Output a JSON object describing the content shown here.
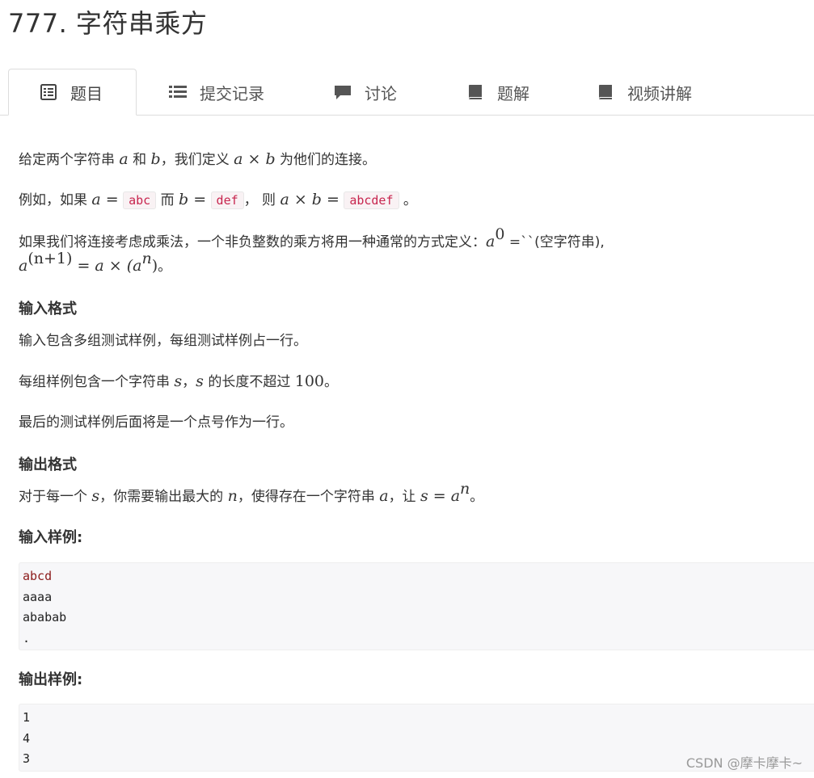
{
  "problem": {
    "title": "777. 字符串乘方"
  },
  "tabs": [
    {
      "label": "题目",
      "icon": "list-alt-icon"
    },
    {
      "label": "提交记录",
      "icon": "list-icon"
    },
    {
      "label": "讨论",
      "icon": "comment-icon"
    },
    {
      "label": "题解",
      "icon": "book-icon"
    },
    {
      "label": "视频讲解",
      "icon": "book-icon"
    }
  ],
  "desc": {
    "p1": {
      "a": "给定两个字符串 ",
      "b": " 和 ",
      "c": "，我们定义 ",
      "d": " 为他们的连接。",
      "var_a": "a",
      "var_b": "b",
      "expr": "a × b"
    },
    "p2": {
      "a": "例如，如果 ",
      "eq_a": "a =",
      "code1": "abc",
      "b": " 而 ",
      "eq_b": "b =",
      "code2": "def",
      "c": "， 则 ",
      "eq_ab": "a × b =",
      "code3": "abcdef",
      "d": " 。"
    },
    "p3": {
      "a": "如果我们将连接考虑成乘法，一个非负整数的乘方将用一种通常的方式定义：",
      "base": "a",
      "sup0": "0",
      "eq": " =``(空字符串),",
      "l2_base": "a",
      "l2_sup": "(n+1)",
      "l2_eq": " = a × (a",
      "l2_sup2": "n",
      "l2_end": ")",
      "l2_period": "。"
    }
  },
  "input_format": {
    "heading": "输入格式",
    "p1": "输入包含多组测试样例，每组测试样例占一行。",
    "p2": {
      "a": "每组样例包含一个字符串 ",
      "s1": "s",
      "b": "，",
      "s2": "s",
      "c": " 的长度不超过 ",
      "n": "100",
      "d": "。"
    },
    "p3": "最后的测试样例后面将是一个点号作为一行。"
  },
  "output_format": {
    "heading": "输出格式",
    "p1": {
      "a": "对于每一个 ",
      "s": "s",
      "b": "，你需要输出最大的 ",
      "n": "n",
      "c": "，使得存在一个字符串 ",
      "av": "a",
      "d": "，让 ",
      "eq": "s = a",
      "sup": "n",
      "e": "。"
    }
  },
  "sample_input": {
    "heading": "输入样例:",
    "lines": [
      "abcd",
      "aaaa",
      "ababab",
      "."
    ]
  },
  "sample_output": {
    "heading": "输出样例:",
    "lines": [
      "1",
      "4",
      "3"
    ]
  },
  "watermark": "CSDN @摩卡摩卡~"
}
